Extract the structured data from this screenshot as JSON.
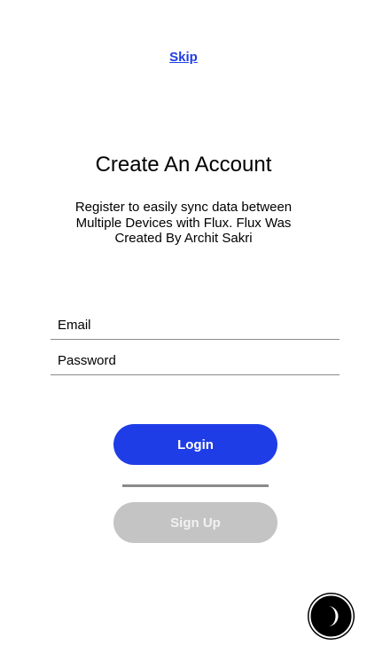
{
  "header": {
    "skip_label": "Skip"
  },
  "intro": {
    "title": "Create An Account",
    "subtitle": "Register to easily sync data between Multiple Devices with Flux. Flux Was Created By Archit Sakri"
  },
  "form": {
    "email_placeholder": "Email",
    "password_placeholder": "Password"
  },
  "actions": {
    "login_label": "Login",
    "signup_label": "Sign Up"
  },
  "theme_toggle": {
    "icon": "moon-icon"
  },
  "colors": {
    "accent": "#1f3de6",
    "disabled": "#c4c4c4",
    "divider": "#8a8a8a"
  }
}
